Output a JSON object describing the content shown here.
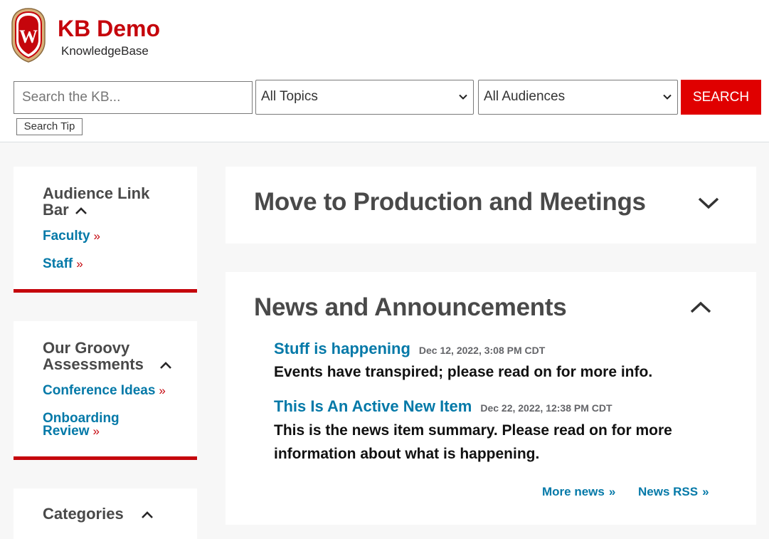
{
  "header": {
    "title": "KB Demo",
    "subtitle": "KnowledgeBase",
    "crest_letter": "W"
  },
  "search": {
    "placeholder": "Search the KB...",
    "topics_selected": "All Topics",
    "audiences_selected": "All Audiences",
    "button_label": "SEARCH",
    "tip_label": "Search Tip"
  },
  "sidebar": {
    "audience": {
      "title_line1": "Audience Link",
      "title_line2": "Bar",
      "links": [
        "Faculty",
        "Staff"
      ]
    },
    "assessments": {
      "title_line1": "Our Groovy",
      "title_line2": "Assessments",
      "links": [
        {
          "line1": "Conference Ideas",
          "line2": ""
        },
        {
          "line1": "Onboarding",
          "line2": "Review"
        }
      ]
    },
    "categories": {
      "title": "Categories"
    }
  },
  "main": {
    "production_title": "Move to Production and Meetings",
    "news_title": "News and Announcements",
    "news": [
      {
        "title": "Stuff is happening",
        "date": "Dec 12, 2022, 3:08 PM CDT",
        "summary": "Events have transpired; please read on for more info."
      },
      {
        "title": "This Is An Active New Item",
        "date": "Dec 22, 2022, 12:38 PM CDT",
        "summary": "This is the news item summary. Please read on for more information about what is happening."
      }
    ],
    "more_news_label": "More news",
    "rss_label": "News RSS"
  },
  "colors": {
    "brand_red": "#c5050c",
    "search_button": "#e00000",
    "link_blue": "#0479a8",
    "heading_gray": "#494949"
  },
  "icons": {
    "crest": "uw-crest-icon",
    "select_arrow": "chevron-down-icon",
    "expand": "chevron-down-icon",
    "collapse": "chevron-up-icon",
    "link_arrow": "double-chevron-right-icon"
  }
}
